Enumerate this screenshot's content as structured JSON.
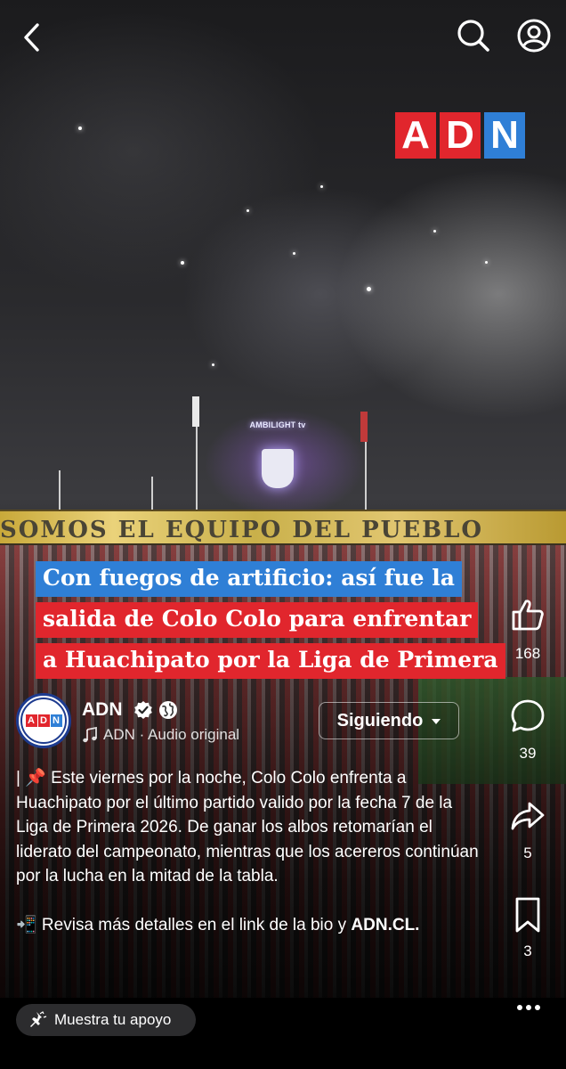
{
  "brand": {
    "logo_letters": [
      "A",
      "D",
      "N"
    ],
    "colors": {
      "red": "#e1262d",
      "blue": "#2f7fd6",
      "dark_blue": "#1d3b8f"
    }
  },
  "video": {
    "banner_text": "SOMOS EL EQUIPO DEL PUEBLO",
    "screen_text": "AMBILIGHT tv",
    "headline_lines": [
      "Con fuegos de artificio: así fue la",
      "salida de Colo Colo para enfrentar",
      "a Huachipato por la Liga de Primera"
    ]
  },
  "topbar": {
    "back_icon": "chevron-left-icon",
    "search_icon": "search-icon",
    "profile_icon": "profile-icon"
  },
  "actions": {
    "likes": "168",
    "comments": "39",
    "shares": "5",
    "saves": "3"
  },
  "account": {
    "name": "ADN",
    "audio_label": "ADN · Audio original",
    "follow_label": "Siguiendo"
  },
  "caption": {
    "paragraph1": "| 📌 Este viernes por la noche, Colo Colo enfrenta a Huachipato por el último partido valido por la fecha 7 de la Liga de Primera 2026. De ganar los albos retomarían el liderato del campeonato, mientras que los acereros continúan por la lucha en la mitad de la tabla.",
    "paragraph2_prefix": "📲 Revisa más detalles en el link de la bio y",
    "paragraph2_link": "ADN.CL."
  },
  "bottom": {
    "support_label": "Muestra tu apoyo"
  }
}
